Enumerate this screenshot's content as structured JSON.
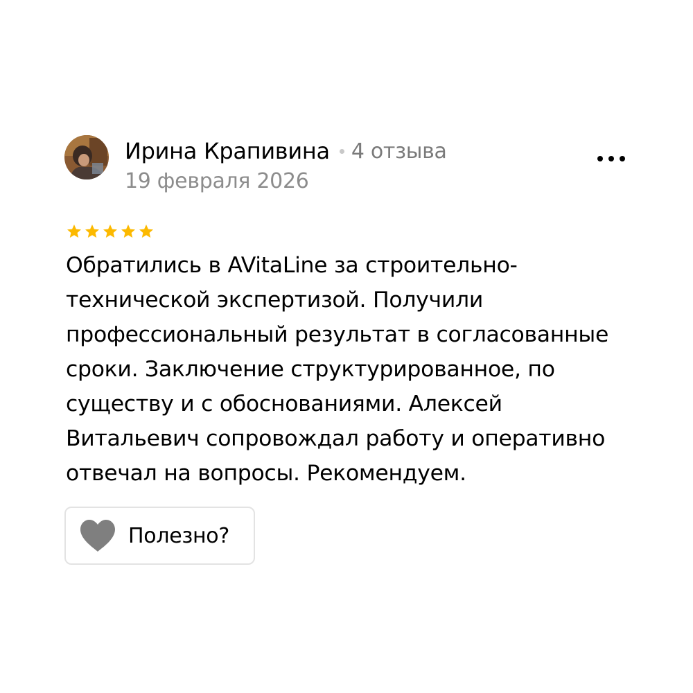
{
  "author": {
    "name": "Ирина Крапивина",
    "review_count": "4 отзыва",
    "avatar_icon": "user-photo-avatar"
  },
  "review": {
    "date": "19 февраля 2026",
    "rating": 5,
    "rating_max": 5,
    "text_lines": [
      "Обратились в AVitaLine за строительно-",
      "технической экспертизой. Получили",
      "профессиональный результат в согласованные",
      "сроки. Заключение структурированное, по",
      "существу и с обоснованиями. Алексей",
      "Витальевич сопровождал работу и оперативно",
      "отвечал на вопросы. Рекомендуем."
    ]
  },
  "actions": {
    "more_icon": "more-dots-icon",
    "helpful_label": "Полезно?",
    "helpful_icon": "heart-icon"
  },
  "colors": {
    "star": "#fcb900",
    "heart": "#7f7f7f",
    "secondary_text": "#7a7a7a",
    "border": "#e3e3e3"
  }
}
